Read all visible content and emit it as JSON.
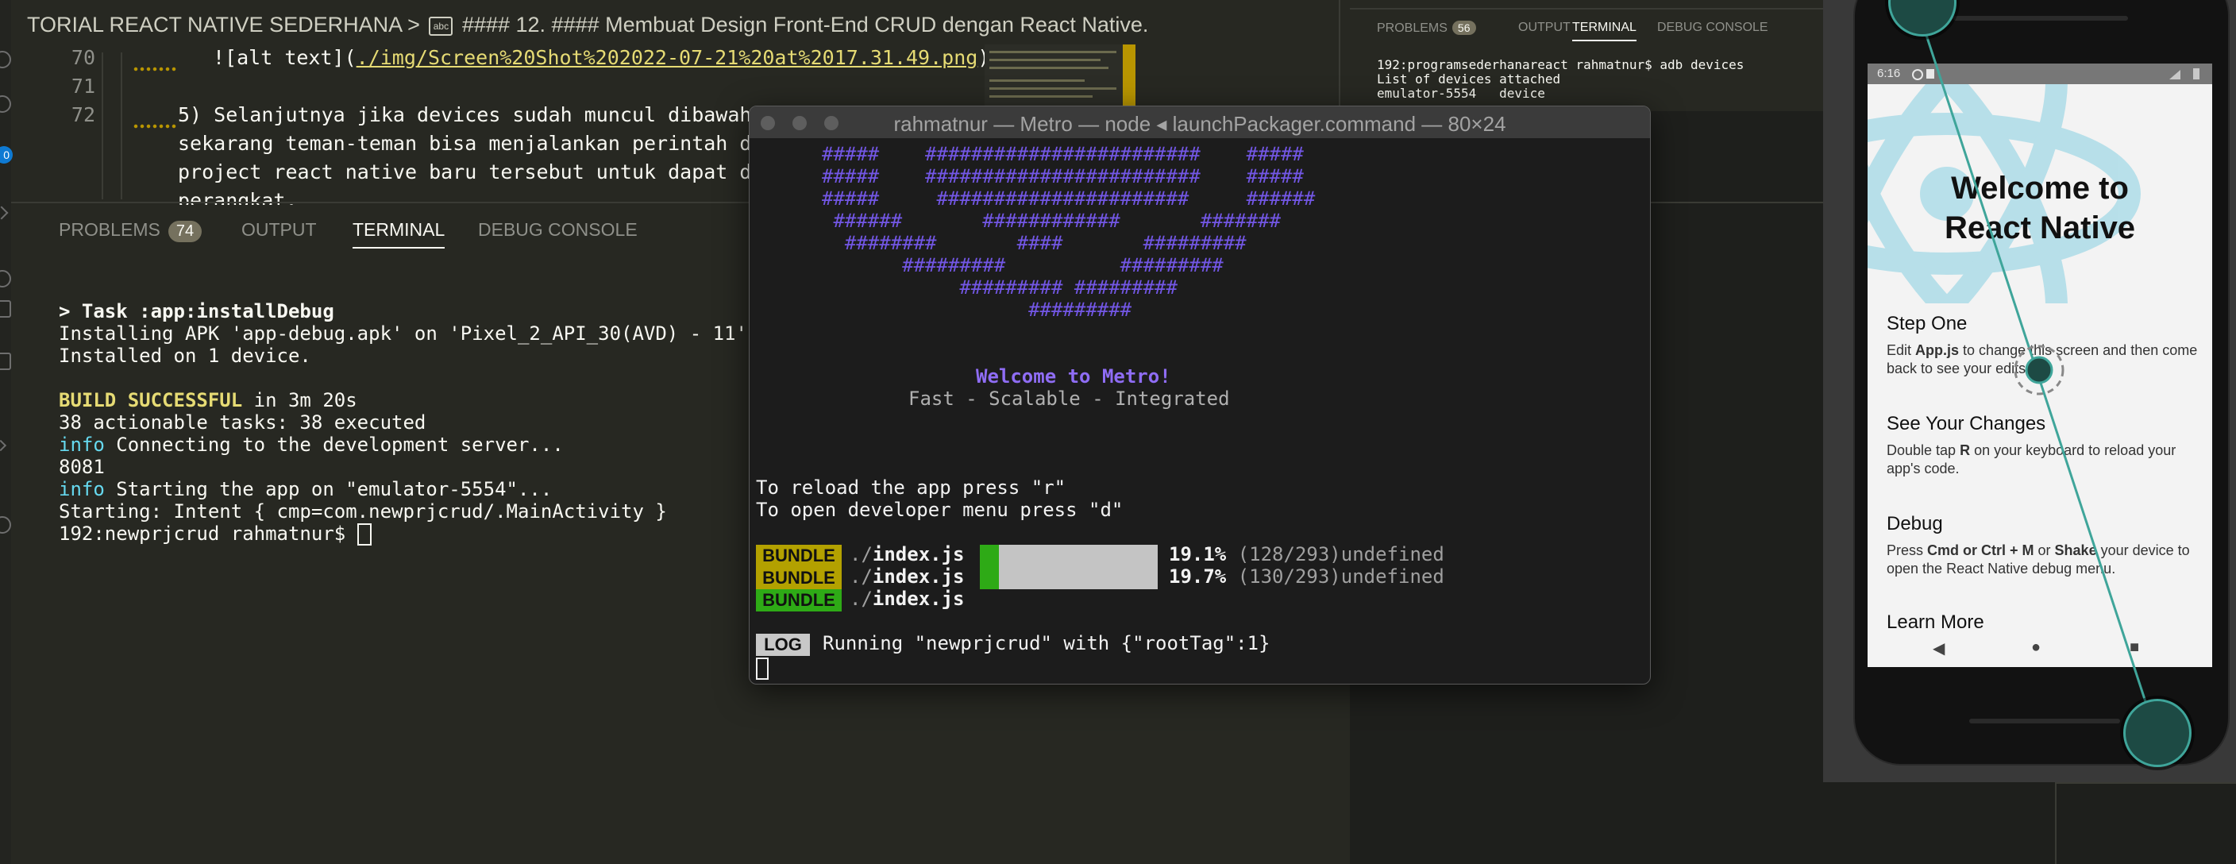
{
  "editor": {
    "breadcrumb": {
      "folder": "TORIAL REACT NATIVE SEDERHANA",
      "separator": ">",
      "icon_text": "abc",
      "heading": "#### 12. #### Membuat Design Front-End CRUD dengan React Native."
    },
    "lines": [
      {
        "number": "70",
        "prefix": "![",
        "alt": "alt text",
        "mid": "](",
        "path": "./img/Screen%20Shot%202022-07-21%20at%2017.31.49.png",
        "suffix": ")"
      },
      {
        "number": "71"
      },
      {
        "number": "72",
        "text": "5) Selanjutnya jika devices sudah muncul dibawah"
      }
    ],
    "wrapped_lines": [
      "sekarang teman-teman bisa menjalankan perintah dib",
      "project react native baru tersebut untuk dapat dia",
      "perangkat."
    ]
  },
  "panel": {
    "tabs": [
      {
        "label": "PROBLEMS",
        "badge": "74"
      },
      {
        "label": "OUTPUT"
      },
      {
        "label": "TERMINAL",
        "active": true
      },
      {
        "label": "DEBUG CONSOLE"
      }
    ],
    "terminal": {
      "task": "> Task :app:installDebug",
      "installing": "Installing APK 'app-debug.apk' on 'Pixel_2_API_30(AVD) - 11' f",
      "installed": "Installed on 1 device.",
      "build_status": "BUILD SUCCESSFUL",
      "build_time": " in 3m 20s",
      "tasks": "38 actionable tasks: 38 executed",
      "info1_tag": "info",
      "info1_text": " Connecting to the development server...",
      "port": "8081",
      "info2_tag": "info",
      "info2_text": " Starting the app on \"emulator-5554\"...",
      "intent": "Starting: Intent { cmp=com.newprjcrud/.MainActivity }",
      "prompt": "192:newprjcrud rahmatnur$ "
    }
  },
  "right_panel": {
    "tabs": [
      {
        "label": "PROBLEMS",
        "badge": "56"
      },
      {
        "label": "OUTPUT"
      },
      {
        "label": "TERMINAL",
        "active": true
      },
      {
        "label": "DEBUG CONSOLE"
      }
    ],
    "lines": [
      "192:programsederhanareact rahmatnur$ adb devices",
      "List of devices attached",
      "emulator-5554   device"
    ]
  },
  "metro": {
    "title": "rahmatnur — Metro — node ◂ launchPackager.command — 80×24",
    "ascii_logo": [
      "#####    ########################    #####",
      "#####    ########################    #####",
      "#####     ######################     ######",
      " ######       ############       #######",
      "  ########       ####       #########",
      "       #########          #########",
      "            ######### #########",
      "                  #########"
    ],
    "welcome": "Welcome to Metro!",
    "tagline": "Fast - Scalable - Integrated",
    "reload_hint": "To reload the app press \"r\"",
    "devmenu_hint": "To open developer menu press \"d\"",
    "bundles": [
      {
        "tag": "BUNDLE",
        "path_prefix": "./",
        "file": "index.js",
        "percent": "19.1%",
        "counts": "(128/293)undefined",
        "progress": 0.191,
        "color": "#b3a100"
      },
      {
        "tag": "BUNDLE",
        "path_prefix": "./",
        "file": "index.js",
        "percent": "19.7%",
        "counts": "(130/293)undefined",
        "progress": 0.197,
        "color": "#b3a100"
      },
      {
        "tag": "BUNDLE",
        "path_prefix": "./",
        "file": "index.js",
        "color": "#2eaa16"
      }
    ],
    "log_tag": "LOG",
    "log_text": "Running \"newprjcrud\" with {\"rootTag\":1}"
  },
  "emulator": {
    "status_time": "6:16",
    "app": {
      "title": "Welcome to React Native",
      "title_line1": "Welcome to",
      "title_line2": "React Native",
      "sections": [
        {
          "title": "Step One",
          "pre": "Edit ",
          "bold1": "App.js",
          "post": " to change this screen and then come back to see your edits."
        },
        {
          "title": "See Your Changes",
          "pre": "Double tap ",
          "bold1": "R",
          "post": " on your keyboard to reload your app's code."
        },
        {
          "title": "Debug",
          "pre": "Press ",
          "bold1": "Cmd or Ctrl + M",
          "mid": " or ",
          "bold2": "Shake",
          "post": " your device to open the React Native debug menu."
        },
        {
          "title": "Learn More"
        }
      ]
    },
    "nav": {
      "back": "◀",
      "home": "●",
      "recents": "■"
    }
  },
  "colors": {
    "editor_bg": "#272822",
    "metro_bg": "#1c1c1c",
    "metro_logo": "#7357e6",
    "bundle_yellow": "#b3a100",
    "bundle_green": "#2eaa16",
    "progress_green": "#2eaa16",
    "touch_line": "#3fa59a"
  }
}
